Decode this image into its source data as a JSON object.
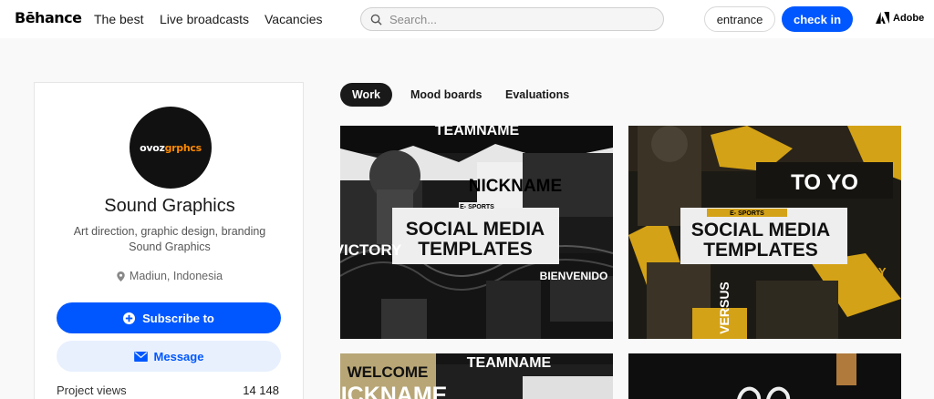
{
  "header": {
    "logo": "Bēhance",
    "nav": [
      "The best",
      "Live broadcasts",
      "Vacancies"
    ],
    "search_placeholder": "Search...",
    "entrance_label": "entrance",
    "checkin_label": "check in",
    "adobe_label": "Adobe"
  },
  "profile": {
    "avatar_text_white": "ovoz",
    "avatar_text_accent": "grphcs",
    "name": "Sound Graphics",
    "occupation_line1": "Art direction, graphic design, branding",
    "occupation_line2": "Sound Graphics",
    "location": "Madiun, Indonesia",
    "subscribe_label": "Subscribe to",
    "message_label": "Message",
    "stat_label": "Project views",
    "stat_value": "14 148"
  },
  "tabs": [
    "Work",
    "Mood boards",
    "Evaluations"
  ],
  "projects": [
    {
      "tag": "E- SPORTS",
      "line1": "SOCIAL MEDIA",
      "line2": "TEMPLATES",
      "top_text": "TEAMNAME",
      "nick": "NICKNAME",
      "victory": "VICTORY",
      "extra": "BIENVENIDO",
      "accent": "#e6e6e6"
    },
    {
      "tag": "E- SPORTS",
      "line1": "SOCIAL MEDIA",
      "line2": "TEMPLATES",
      "top_text": "TO  YO",
      "nick": "",
      "victory": "VICTORY",
      "extra": "VERSUS",
      "accent": "#d4a216"
    },
    {
      "top_text": "WELCOME",
      "nick": "NICKNAME",
      "extra": "TEAMNAME",
      "accent": "#b8a676"
    },
    {
      "extra": "",
      "accent": "#b07a3c"
    }
  ]
}
